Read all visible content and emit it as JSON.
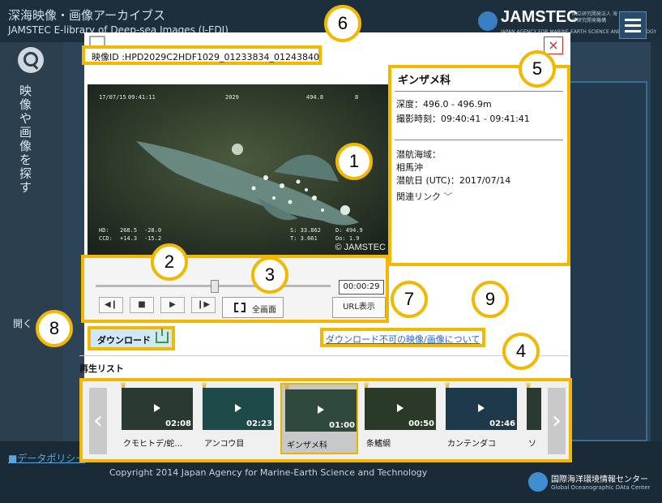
{
  "header": {
    "title": "深海映像・画像アーカイブス",
    "subtitle": "JAMSTEC E-library of Deep-sea Images (J-EDI)",
    "logo_text": "JAMSTEC",
    "logo_sub": "JAPAN AGENCY FOR MARINE-EARTH SCIENCE AND TECHNOLOGY",
    "logo_jp": "国立研究開発法人 海洋研究開発機構"
  },
  "sidebar": {
    "search_label": "映像や画像を探す",
    "open_label": "開く"
  },
  "footer": {
    "data_policy": "■データポリシー",
    "copyright": "Copyright 2014 Japan Agency for Marine-Earth Science and Technology",
    "godac_jp": "国際海洋環境情報センター",
    "godac_en": "Global Oceanographic DAta Center"
  },
  "modal": {
    "video_id": "映像ID :HPD2029C2HDF1029_01233834_01243840",
    "close": "×",
    "player": {
      "osd_date": "17/07/15",
      "osd_time": "09:41:11",
      "osd_dive": "2029",
      "osd_depth": "494.8",
      "osd_8": "8",
      "osd_hd": "HD:",
      "osd_ccd": "CCD:",
      "osd_hd_val": "268.5",
      "osd_ccd_val": "+14.3",
      "osd_hd_val2": "-28.0",
      "osd_ccd_val2": "-15.2",
      "osd_s": "S: 33.862",
      "osd_t": "T:  3.661",
      "osd_d": "D:  494.9",
      "osd_do": "Do:   1.9",
      "watermark": "© JAMSTEC"
    },
    "controls": {
      "timecode": "00:00:29",
      "seek_fraction": 0.5,
      "prev_icon": "skip-back-icon",
      "stop_icon": "stop-icon",
      "play_icon": "play-icon",
      "next_icon": "skip-forward-icon",
      "fullscreen_label": "全画面",
      "url_label": "URL表示"
    },
    "info": {
      "species": "ギンザメ科",
      "depth": "深度：496.0 - 496.9m",
      "time": "撮影時刻：09:40:41 - 09:41:41",
      "area_label": "潜航海域：",
      "area_value": "相馬沖",
      "dive_date": "潜航日 (UTC)：2017/07/14",
      "related": "関連リンク"
    },
    "download_label": "ダウンロード",
    "about_link": "ダウンロード不可の映像/画像について",
    "playlist_title": "再生リスト",
    "playlist": [
      {
        "caption": "クモヒトデ/蛇…",
        "duration": "02:08",
        "selected": false
      },
      {
        "caption": "アンコウ目",
        "duration": "02:23",
        "selected": false
      },
      {
        "caption": "ギンザメ科",
        "duration": "01:00",
        "selected": true
      },
      {
        "caption": "条鰭綱",
        "duration": "00:50",
        "selected": false
      },
      {
        "caption": "カンテンダコ",
        "duration": "02:46",
        "selected": false
      },
      {
        "caption": "ソ",
        "duration": "",
        "selected": false
      }
    ]
  },
  "annotations": [
    "1",
    "2",
    "3",
    "4",
    "5",
    "6",
    "7",
    "8",
    "9"
  ],
  "colors": {
    "highlight": "#f2b800",
    "link": "#2466c4"
  }
}
